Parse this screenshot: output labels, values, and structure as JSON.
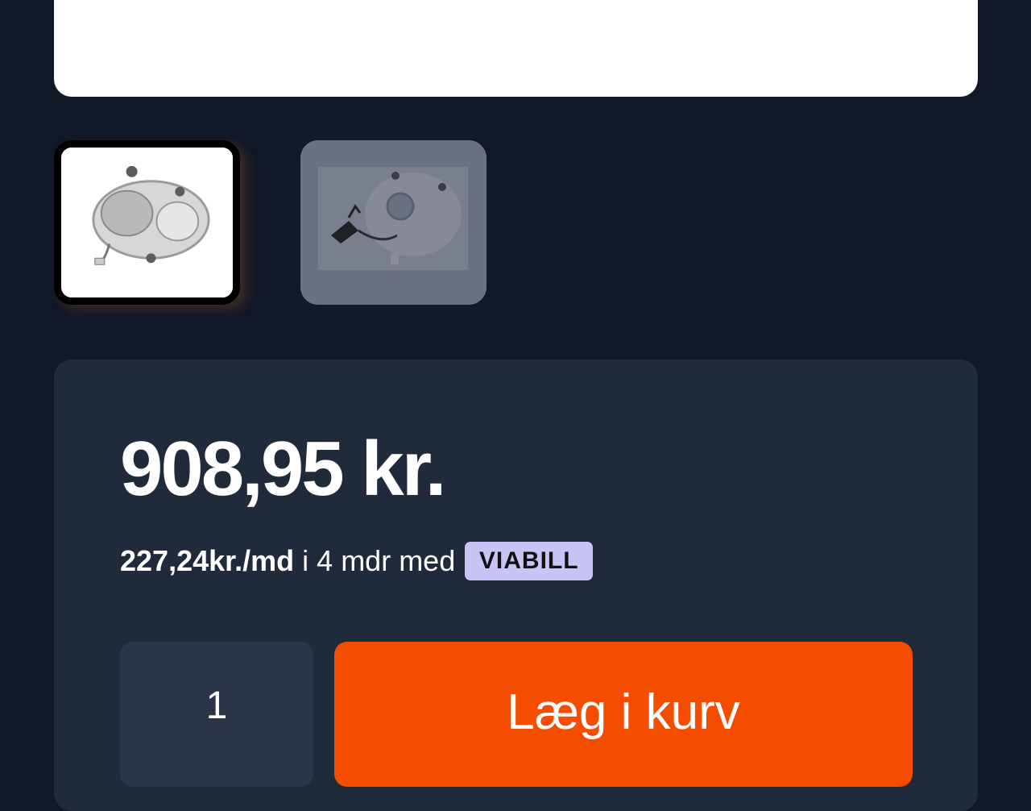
{
  "product": {
    "price": "908,95 kr.",
    "installment": {
      "amount": "227,24kr./md",
      "text": "i 4 mdr med",
      "provider_logo_text": "VIABILL",
      "provider_badge_color": "#c8c4f5"
    },
    "quantity": "1",
    "add_to_cart_label": "Læg i kurv",
    "thumbnails": [
      {
        "icon": "headlight-image",
        "selected": true
      },
      {
        "icon": "headlight-parts-image",
        "selected": false
      }
    ]
  },
  "colors": {
    "background": "#111827",
    "card": "#1f2a3a",
    "quantity_box": "#29364a",
    "accent": "#f54d00"
  }
}
